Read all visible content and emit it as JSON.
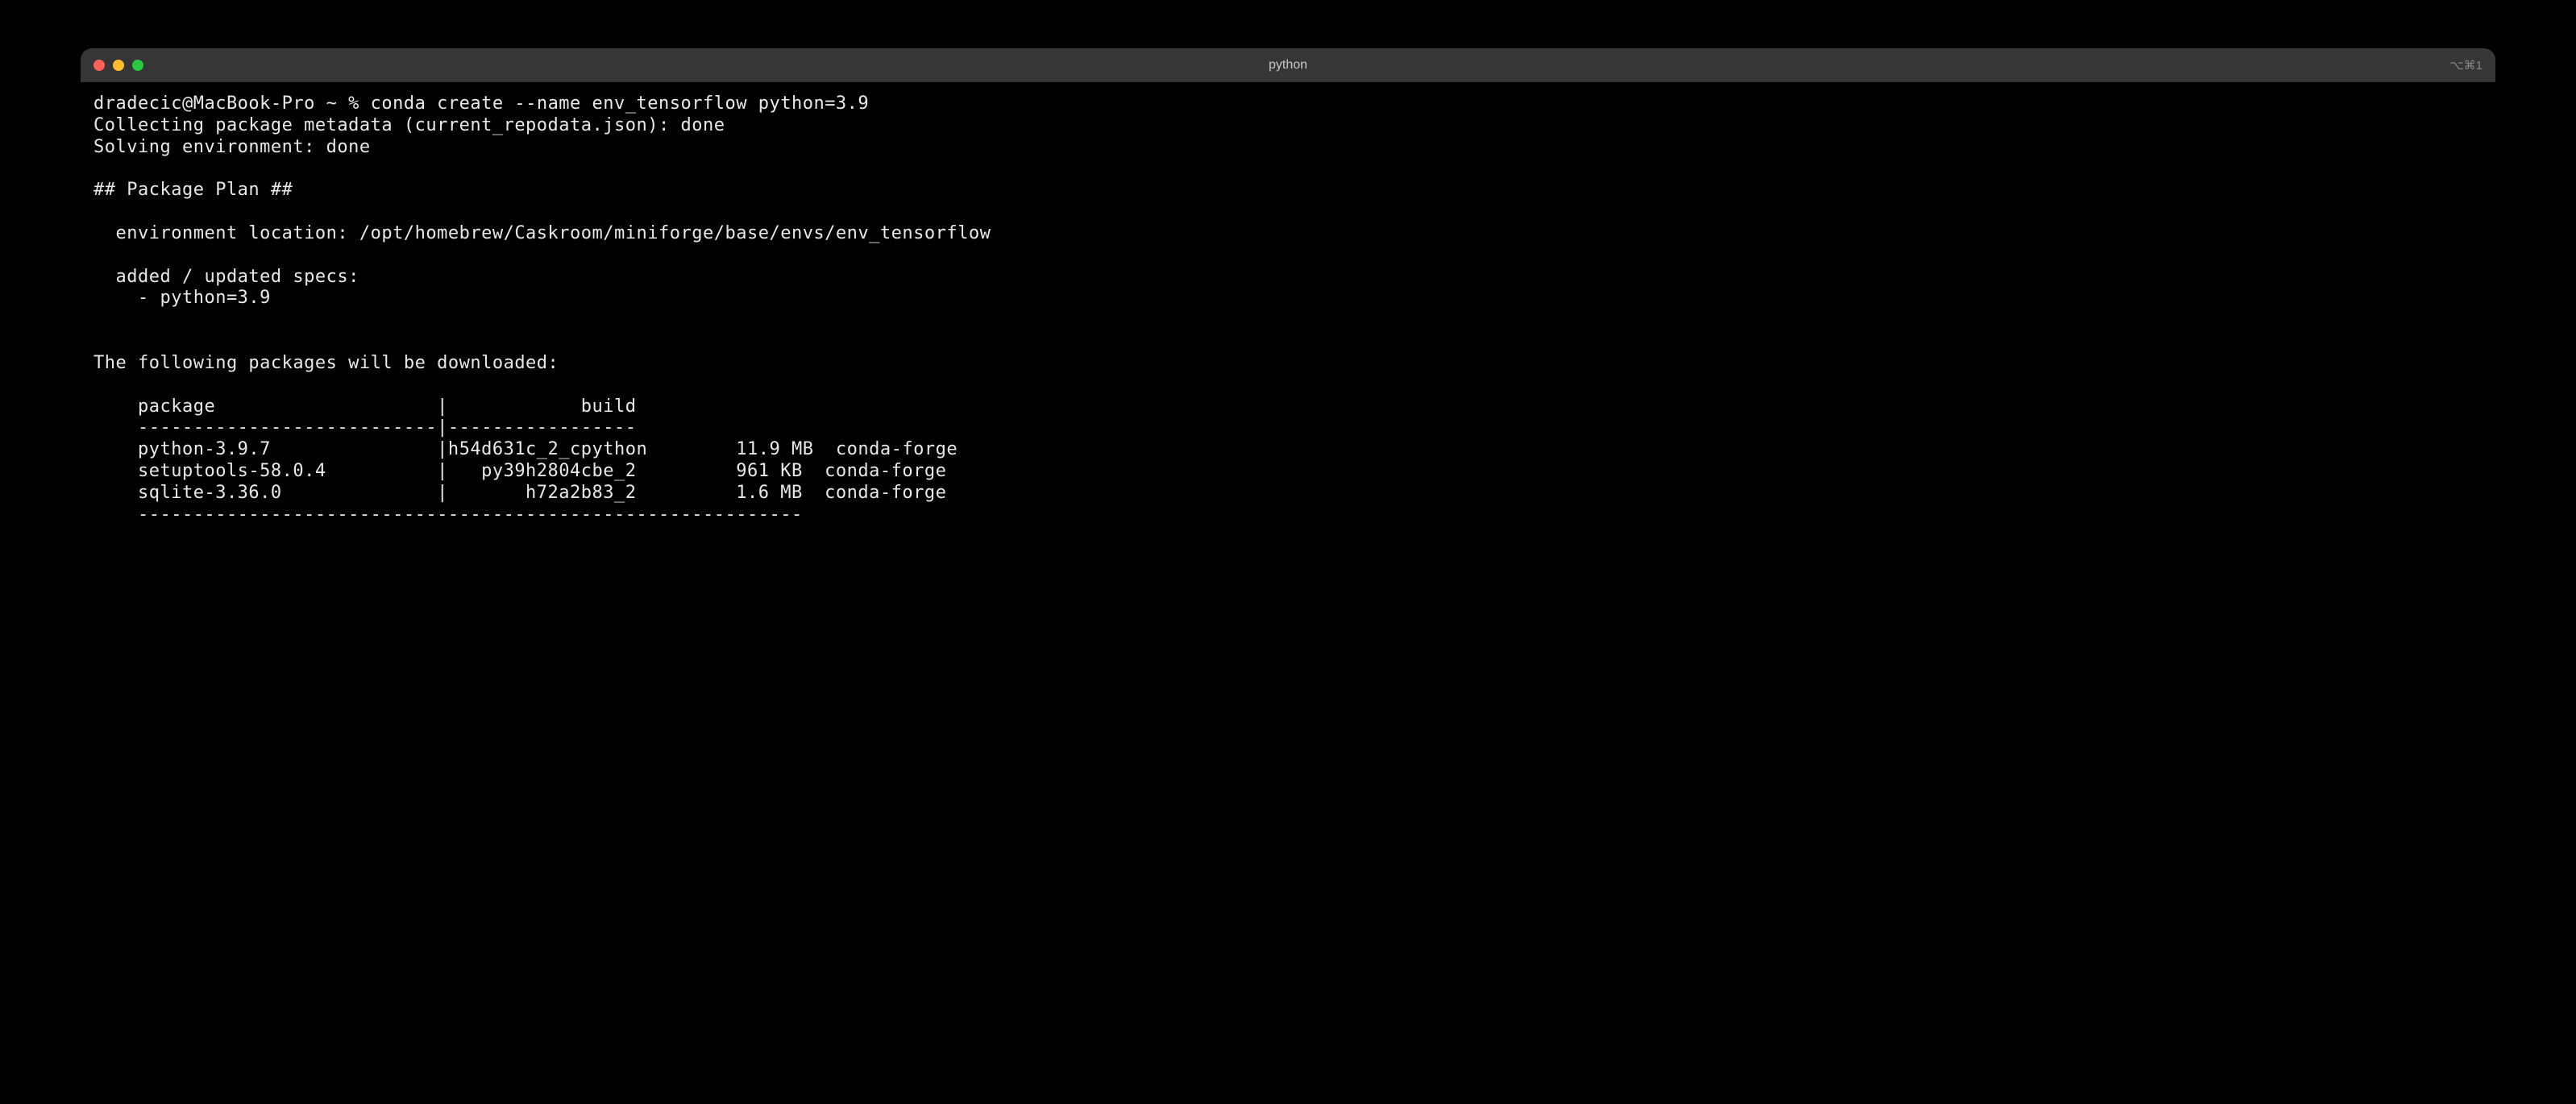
{
  "titlebar": {
    "title": "python",
    "shortcut": "⌥⌘1"
  },
  "terminal": {
    "prompt": "dradecic@MacBook-Pro ~ %",
    "command": "conda create --name env_tensorflow python=3.9",
    "lines": {
      "collecting": "Collecting package metadata (current_repodata.json): done",
      "solving": "Solving environment: done",
      "blank1": "",
      "plan_header": "## Package Plan ##",
      "blank2": "",
      "env_location": "  environment location: /opt/homebrew/Caskroom/miniforge/base/envs/env_tensorflow",
      "blank3": "",
      "added_specs": "  added / updated specs:",
      "spec_item": "    - python=3.9",
      "blank4": "",
      "blank5": "",
      "download_header": "The following packages will be downloaded:",
      "blank6": "",
      "table_header": "    package                    |            build",
      "table_sep": "    ---------------------------|-----------------",
      "pkg1": "    python-3.9.7               |h54d631c_2_cpython        11.9 MB  conda-forge",
      "pkg2": "    setuptools-58.0.4          |   py39h2804cbe_2         961 KB  conda-forge",
      "pkg3": "    sqlite-3.36.0              |       h72a2b83_2         1.6 MB  conda-forge",
      "table_foot": "    ------------------------------------------------------------"
    }
  }
}
